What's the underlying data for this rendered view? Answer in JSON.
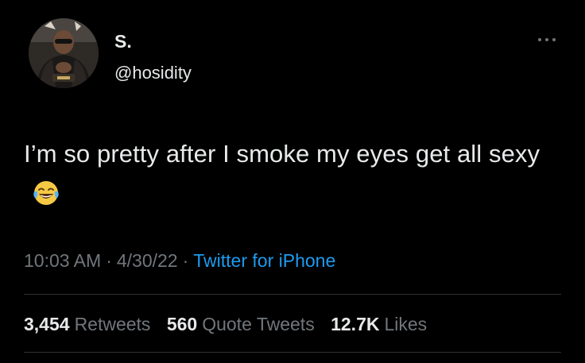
{
  "tweet": {
    "author": {
      "display_name": "S.",
      "handle": "@hosidity"
    },
    "text": "I’m so pretty after I smoke my eyes get all sexy",
    "emoji": "face-with-tears-of-joy",
    "time": "10:03 AM",
    "date": "4/30/22",
    "separator": "·",
    "source": "Twitter for iPhone",
    "stats": {
      "retweets_count": "3,454",
      "retweets_label": "Retweets",
      "quotes_count": "560",
      "quotes_label": "Quote Tweets",
      "likes_count": "12.7K",
      "likes_label": "Likes"
    }
  },
  "colors": {
    "background": "#000000",
    "text": "#e7e9ea",
    "secondary": "#71767b",
    "link": "#1d9bf0",
    "divider": "#2f3336"
  }
}
